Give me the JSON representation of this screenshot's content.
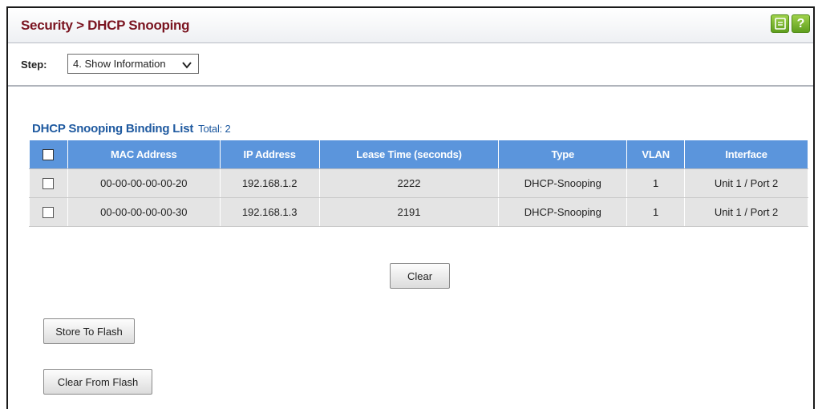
{
  "header": {
    "title": "Security > DHCP Snooping",
    "icons": [
      "save-icon",
      "help-icon"
    ],
    "help_glyph": "?"
  },
  "step": {
    "label": "Step:",
    "selected": "4. Show Information"
  },
  "binding_list": {
    "title": "DHCP Snooping Binding List",
    "total": "Total: 2",
    "columns": [
      "MAC Address",
      "IP Address",
      "Lease Time (seconds)",
      "Type",
      "VLAN",
      "Interface"
    ],
    "rows": [
      {
        "mac": "00-00-00-00-00-20",
        "ip": "192.168.1.2",
        "lease": "2222",
        "type": "DHCP-Snooping",
        "vlan": "1",
        "interface": "Unit 1 / Port 2"
      },
      {
        "mac": "00-00-00-00-00-30",
        "ip": "192.168.1.3",
        "lease": "2191",
        "type": "DHCP-Snooping",
        "vlan": "1",
        "interface": "Unit 1 / Port 2"
      }
    ]
  },
  "buttons": {
    "clear": "Clear",
    "store_to_flash": "Store To Flash",
    "clear_from_flash": "Clear From Flash"
  },
  "colors": {
    "title": "#7a1420",
    "section_title": "#1f5aa0",
    "table_header": "#5b95dc",
    "row_background": "#e4e4e4",
    "icon_green": "#6aab24"
  }
}
